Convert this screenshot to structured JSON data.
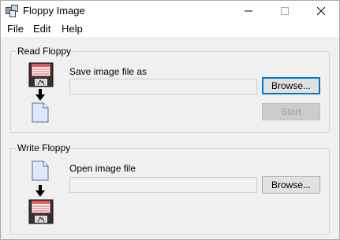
{
  "window": {
    "title": "Floppy Image"
  },
  "menu": [
    "File",
    "Edit",
    "Help"
  ],
  "read_group": {
    "legend": "Read Floppy",
    "field_label": "Save image file as",
    "field_value": "",
    "browse_label": "Browse...",
    "start_label": "Start"
  },
  "write_group": {
    "legend": "Write Floppy",
    "field_label": "Open image file",
    "field_value": "",
    "browse_label": "Browse..."
  },
  "colors": {
    "accent": "#0078d7",
    "floppy_red": "#c0392b",
    "floppy_dark": "#333333",
    "doc_blue": "#dbe9fb"
  },
  "icons": [
    "app-icon",
    "floppy-disk-icon",
    "down-arrow-icon",
    "document-icon",
    "minimize-icon",
    "maximize-icon",
    "close-icon"
  ]
}
